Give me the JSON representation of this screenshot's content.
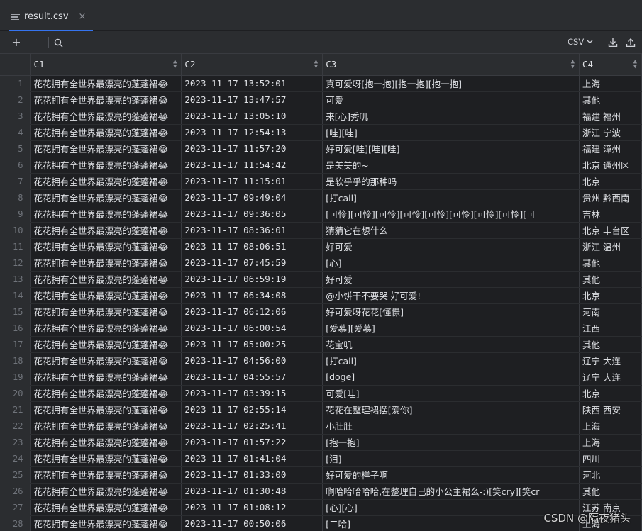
{
  "tab": {
    "label": "result.csv",
    "close": "×"
  },
  "toolbar": {
    "add": "+",
    "remove": "—",
    "format": "CSV",
    "chevron": "⌵"
  },
  "columns": [
    "C1",
    "C2",
    "C3",
    "C4"
  ],
  "rows": [
    [
      "1",
      "花花拥有全世界最漂亮的蓬蓬裙😂",
      "2023-11-17 13:52:01",
      "真可爱呀[抱一抱][抱一抱][抱一抱]",
      "上海"
    ],
    [
      "2",
      "花花拥有全世界最漂亮的蓬蓬裙😂",
      "2023-11-17 13:47:57",
      "可爱",
      "其他"
    ],
    [
      "3",
      "花花拥有全世界最漂亮的蓬蓬裙😂",
      "2023-11-17 13:05:10",
      "来[心]秀叽",
      "福建 福州"
    ],
    [
      "4",
      "花花拥有全世界最漂亮的蓬蓬裙😂",
      "2023-11-17 12:54:13",
      "[哇][哇]",
      "浙江 宁波"
    ],
    [
      "5",
      "花花拥有全世界最漂亮的蓬蓬裙😂",
      "2023-11-17 11:57:20",
      "好可爱[哇][哇][哇]",
      "福建 漳州"
    ],
    [
      "6",
      "花花拥有全世界最漂亮的蓬蓬裙😂",
      "2023-11-17 11:54:42",
      "是美美的~",
      "北京 通州区"
    ],
    [
      "7",
      "花花拥有全世界最漂亮的蓬蓬裙😂",
      "2023-11-17 11:15:01",
      "是软乎乎的那种吗",
      "北京"
    ],
    [
      "8",
      "花花拥有全世界最漂亮的蓬蓬裙😂",
      "2023-11-17 09:49:04",
      "[打call]",
      "贵州 黔西南"
    ],
    [
      "9",
      "花花拥有全世界最漂亮的蓬蓬裙😂",
      "2023-11-17 09:36:05",
      "[可怜][可怜][可怜][可怜][可怜][可怜][可怜][可怜][可",
      "吉林"
    ],
    [
      "10",
      "花花拥有全世界最漂亮的蓬蓬裙😂",
      "2023-11-17 08:36:01",
      "猜猜它在想什么",
      "北京 丰台区"
    ],
    [
      "11",
      "花花拥有全世界最漂亮的蓬蓬裙😂",
      "2023-11-17 08:06:51",
      "好可爱",
      "浙江 温州"
    ],
    [
      "12",
      "花花拥有全世界最漂亮的蓬蓬裙😂",
      "2023-11-17 07:45:59",
      "[心]",
      "其他"
    ],
    [
      "13",
      "花花拥有全世界最漂亮的蓬蓬裙😂",
      "2023-11-17 06:59:19",
      "好可爱",
      "其他"
    ],
    [
      "14",
      "花花拥有全世界最漂亮的蓬蓬裙😂",
      "2023-11-17 06:34:08",
      "@小饼干不要哭 好可爱!",
      "北京"
    ],
    [
      "15",
      "花花拥有全世界最漂亮的蓬蓬裙😂",
      "2023-11-17 06:12:06",
      "好可爱呀花花[懂憬]",
      "河南"
    ],
    [
      "16",
      "花花拥有全世界最漂亮的蓬蓬裙😂",
      "2023-11-17 06:00:54",
      "[爱慕][爱慕]",
      "江西"
    ],
    [
      "17",
      "花花拥有全世界最漂亮的蓬蓬裙😂",
      "2023-11-17 05:00:25",
      "花宝叽",
      "其他"
    ],
    [
      "18",
      "花花拥有全世界最漂亮的蓬蓬裙😂",
      "2023-11-17 04:56:00",
      "[打call]",
      "辽宁 大连"
    ],
    [
      "19",
      "花花拥有全世界最漂亮的蓬蓬裙😂",
      "2023-11-17 04:55:57",
      "[doge]",
      "辽宁 大连"
    ],
    [
      "20",
      "花花拥有全世界最漂亮的蓬蓬裙😂",
      "2023-11-17 03:39:15",
      "可爱[哇]",
      "北京"
    ],
    [
      "21",
      "花花拥有全世界最漂亮的蓬蓬裙😂",
      "2023-11-17 02:55:14",
      "花花在整理裙摆[爱你]",
      "陕西 西安"
    ],
    [
      "22",
      "花花拥有全世界最漂亮的蓬蓬裙😂",
      "2023-11-17 02:25:41",
      "小肚肚",
      "上海"
    ],
    [
      "23",
      "花花拥有全世界最漂亮的蓬蓬裙😂",
      "2023-11-17 01:57:22",
      "[抱一抱]",
      "上海"
    ],
    [
      "24",
      "花花拥有全世界最漂亮的蓬蓬裙😂",
      "2023-11-17 01:41:04",
      "[泪]",
      "四川"
    ],
    [
      "25",
      "花花拥有全世界最漂亮的蓬蓬裙😂",
      "2023-11-17 01:33:00",
      "好可爱的样子啊",
      "河北"
    ],
    [
      "26",
      "花花拥有全世界最漂亮的蓬蓬裙😂",
      "2023-11-17 01:30:48",
      "啊哈哈哈哈哈,在整理自己的小公主裙么-:)[笑cry][笑cr",
      "其他"
    ],
    [
      "27",
      "花花拥有全世界最漂亮的蓬蓬裙😂",
      "2023-11-17 01:08:12",
      "[心][心]",
      "江苏 南京"
    ],
    [
      "28",
      "花花拥有全世界最漂亮的蓬蓬裙😂",
      "2023-11-17 00:50:06",
      "[二哈]",
      "上海"
    ]
  ],
  "watermark": "CSDN @隔夜猪头"
}
